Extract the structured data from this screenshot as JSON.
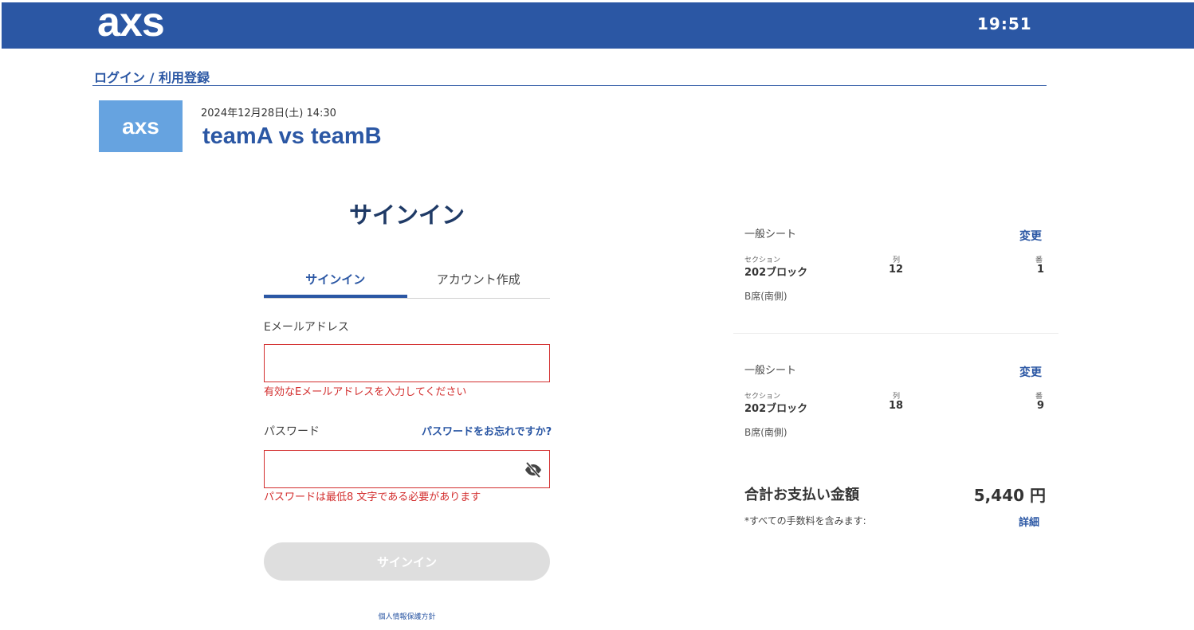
{
  "header": {
    "logo_text": "axs",
    "time": "19:51",
    "bg_color": "#2b57a4"
  },
  "breadcrumb": "ログイン / 利用登録",
  "event": {
    "image_logo": "axs",
    "date": "2024年12月28日(土) 14:30",
    "title": "teamA vs teamB"
  },
  "signin": {
    "heading": "サインイン",
    "tabs": [
      {
        "label": "サインイン",
        "active": true
      },
      {
        "label": "アカウント作成",
        "active": false
      }
    ],
    "email_label": "Eメールアドレス",
    "email_value": "",
    "email_error": "有効なEメールアドレスを入力してください",
    "password_label": "パスワード",
    "password_value": "",
    "forgot_link": "パスワードをお忘れですか?",
    "password_error": "パスワードは最低8 文字である必要があります",
    "eye_icon": "eye-off-icon",
    "submit_label": "サインイン",
    "privacy_link": "個人情報保護方針"
  },
  "seats": [
    {
      "type": "一般シート",
      "change_label": "変更",
      "section_label": "セクション",
      "section_value": "202ブロック",
      "row_label": "列",
      "row_value": "12",
      "seat_label": "番",
      "seat_value": "1",
      "zone": "B席(南側)"
    },
    {
      "type": "一般シート",
      "change_label": "変更",
      "section_label": "セクション",
      "section_value": "202ブロック",
      "row_label": "列",
      "row_value": "18",
      "seat_label": "番",
      "seat_value": "9",
      "zone": "B席(南側)"
    }
  ],
  "total": {
    "label": "合計お支払い金額",
    "value": "5,440 円",
    "fee_note": "*すべての手数料を含みます:",
    "details_link": "詳細"
  }
}
